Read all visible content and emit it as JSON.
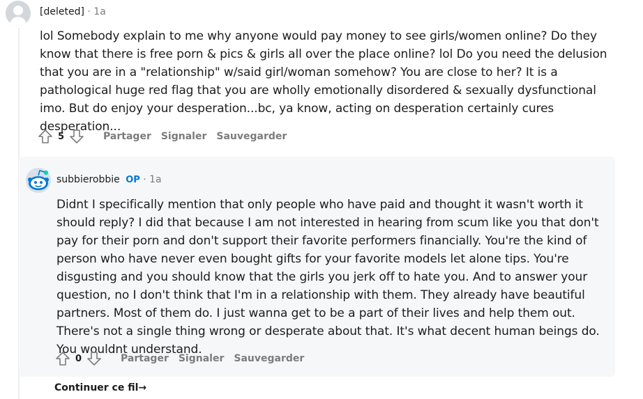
{
  "comment1": {
    "author": "[deleted]",
    "separator": "·",
    "age": "1a",
    "body": "lol Somebody explain to me why anyone would pay money to see girls/women online? Do they know that there is free porn & pics & girls all over the place online? lol Do you need the delusion that you are in a \"relationship\" w/said girl/woman somehow? You are close to her? It is a pathological huge red flag that you are wholly emotionally disordered & sexually dysfunctional imo. But do enjoy your desperation...bc, ya know, acting on desperation certainly cures desperation...",
    "score": "5",
    "actions": {
      "share": "Partager",
      "report": "Signaler",
      "save": "Sauvegarder"
    }
  },
  "comment2": {
    "author": "subbierobbie",
    "op_badge": "OP",
    "separator": "·",
    "age": "1a",
    "body": "Didnt I specifically mention that only people who have paid and thought it wasn't worth it should reply? I did that because I am not interested in hearing from scum like you that don't pay for their porn and don't support their favorite performers financially. You're the kind of person who have never even bought gifts for your favorite models let alone tips. You're disgusting and you should know that the girls you jerk off to hate you. And to answer your question, no I don't think that I'm in a relationship with them. They already have beautiful partners. Most of them do. I just wanna get to be a part of their lives and help them out. There's not a single thing wrong or desperate about that. It's what decent human beings do. You wouldnt understand.",
    "score": "0",
    "actions": {
      "share": "Partager",
      "report": "Signaler",
      "save": "Sauvegarder"
    }
  },
  "continue_thread": "Continuer ce fil",
  "continue_arrow": "→",
  "icons": {
    "upvote": "upvote-arrow-icon",
    "downvote": "downvote-arrow-icon",
    "avatar_deleted": "default-avatar-icon",
    "avatar_snoo": "snoo-avatar-icon"
  },
  "colors": {
    "op": "#0079d3",
    "muted": "#7c7c7c",
    "reply_bg": "#f6f7f8"
  }
}
